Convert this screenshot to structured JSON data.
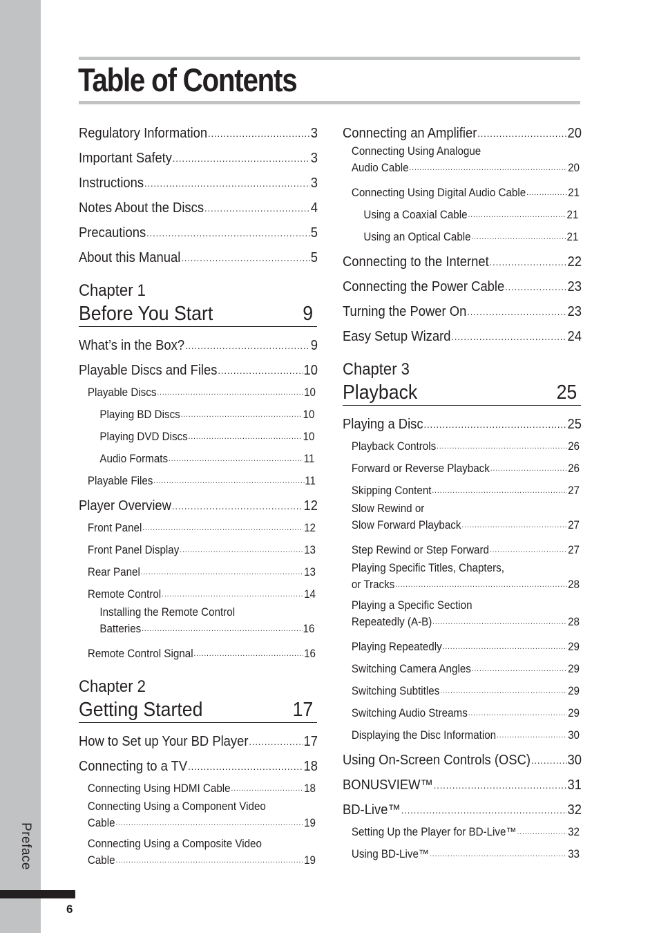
{
  "document": {
    "title": "Table of Contents",
    "side_label": "Preface",
    "page_number": "6",
    "colors": {
      "strip": "#c1c2c4",
      "text": "#231f20",
      "rule": "#c1c2c4"
    }
  },
  "left_column": {
    "intro": [
      {
        "label": "Regulatory Information",
        "page": "3"
      },
      {
        "label": "Important Safety ",
        "page": "3"
      },
      {
        "label": "Instructions",
        "page": "3"
      },
      {
        "label": "Notes About the Discs",
        "page": "4"
      },
      {
        "label": "Precautions",
        "page": "5"
      },
      {
        "label": "About this Manual",
        "page": "5"
      }
    ],
    "chapter1": {
      "number": "Chapter 1",
      "title": "Before You Start",
      "page": "9",
      "entries": [
        {
          "label": "What’s in the Box?",
          "page": "9"
        },
        {
          "label": "Playable Discs and Files",
          "page": "10"
        },
        {
          "label": "Playable Discs",
          "page": "10"
        },
        {
          "label": "Playing BD Discs",
          "page": "10"
        },
        {
          "label": "Playing DVD Discs",
          "page": "10"
        },
        {
          "label": "Audio Formats",
          "page": "11"
        },
        {
          "label": "Playable Files",
          "page": "11"
        },
        {
          "label": "Player Overview",
          "page": "12"
        },
        {
          "label": "Front Panel",
          "page": "12"
        },
        {
          "label": "Front Panel Display",
          "page": "13"
        },
        {
          "label": "Rear Panel",
          "page": "13"
        },
        {
          "label": "Remote Control",
          "page": "14"
        },
        {
          "label_line1": "Installing the Remote Control",
          "label": "Batteries",
          "page": "16"
        },
        {
          "label": "Remote Control Signal",
          "page": "16"
        }
      ]
    },
    "chapter2": {
      "number": "Chapter 2",
      "title": "Getting Started",
      "page": "17",
      "entries": [
        {
          "label": "How to Set up Your BD Player",
          "page": "17"
        },
        {
          "label": "Connecting to a TV",
          "page": "18"
        },
        {
          "label": "Connecting Using HDMI Cable",
          "page": "18"
        },
        {
          "label_line1": "Connecting Using a Component Video",
          "label": "Cable",
          "page": "19"
        },
        {
          "label_line1": "Connecting Using a Composite Video",
          "label": "Cable",
          "page": "19"
        }
      ]
    }
  },
  "right_column": {
    "chapter2_cont": [
      {
        "label": "Connecting an Amplifier",
        "page": "20"
      },
      {
        "label_line1": "Connecting Using Analogue",
        "label": "Audio Cable",
        "page": "20"
      },
      {
        "label": "Connecting Using Digital Audio Cable",
        "page": "21"
      },
      {
        "label": "Using a Coaxial Cable",
        "page": "21"
      },
      {
        "label": "Using an Optical Cable",
        "page": "21"
      },
      {
        "label": "Connecting to the Internet",
        "page": "22"
      },
      {
        "label": "Connecting the Power Cable",
        "page": "23"
      },
      {
        "label": "Turning the Power On",
        "page": "23"
      },
      {
        "label": "Easy Setup Wizard",
        "page": "24"
      }
    ],
    "chapter3": {
      "number": "Chapter 3",
      "title": "Playback",
      "page": "25",
      "entries": [
        {
          "label": "Playing a Disc",
          "page": "25"
        },
        {
          "label": "Playback Controls",
          "page": "26"
        },
        {
          "label": "Forward or Reverse Playback",
          "page": "26"
        },
        {
          "label": "Skipping Content",
          "page": "27"
        },
        {
          "label_line1": "Slow Rewind or",
          "label": "Slow Forward Playback",
          "page": "27"
        },
        {
          "label": "Step Rewind or Step Forward ",
          "page": "27"
        },
        {
          "label_line1": "Playing Specific Titles, Chapters,",
          "label": "or Tracks",
          "page": "28"
        },
        {
          "label_line1": "Playing a Specific Section",
          "label": "Repeatedly (A-B)",
          "page": "28"
        },
        {
          "label": "Playing Repeatedly",
          "page": "29"
        },
        {
          "label": "Switching Camera Angles",
          "page": "29"
        },
        {
          "label": "Switching Subtitles",
          "page": "29"
        },
        {
          "label": "Switching Audio Streams",
          "page": "29"
        },
        {
          "label": "Displaying the Disc Information",
          "page": "30"
        },
        {
          "label": "Using On-Screen Controls (OSC)",
          "page": "30"
        },
        {
          "label": "BONUSVIEW™",
          "page": "31"
        },
        {
          "label": "BD-Live™",
          "page": "32"
        },
        {
          "label": "Setting Up the Player for BD-Live™",
          "page": "32"
        },
        {
          "label": "Using BD-Live™",
          "page": "33"
        }
      ]
    }
  }
}
